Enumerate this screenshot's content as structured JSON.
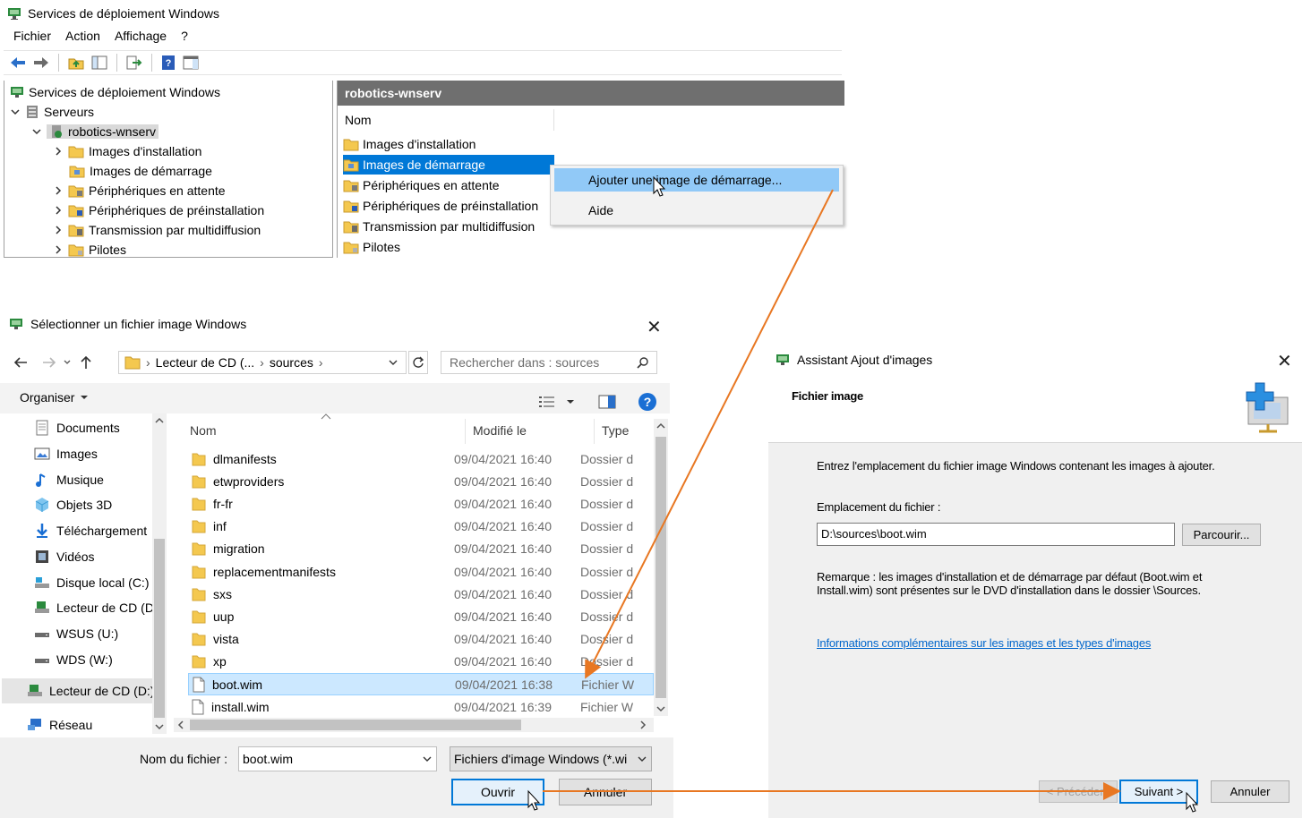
{
  "mmc": {
    "title": "Services de déploiement Windows",
    "menu": [
      "Fichier",
      "Action",
      "Affichage",
      "?"
    ],
    "tree": {
      "root": "Services de déploiement Windows",
      "servers": "Serveurs",
      "server": "robotics-wnserv",
      "children": [
        "Images d'installation",
        "Images de démarrage",
        "Périphériques en attente",
        "Périphériques de préinstallation",
        "Transmission par multidiffusion",
        "Pilotes"
      ]
    },
    "right_header": "robotics-wnserv",
    "column_name": "Nom",
    "items": [
      "Images d'installation",
      "Images de démarrage",
      "Périphériques en attente",
      "Périphériques de préinstallation",
      "Transmission par multidiffusion",
      "Pilotes"
    ],
    "context_menu": [
      "Ajouter une image de démarrage...",
      "Aide"
    ]
  },
  "file_dialog": {
    "title": "Sélectionner un fichier image Windows",
    "address": [
      "Lecteur de CD (...",
      "sources"
    ],
    "search_placeholder": "Rechercher dans : sources",
    "organize": "Organiser",
    "nav": [
      "Documents",
      "Images",
      "Musique",
      "Objets 3D",
      "Téléchargement",
      "Vidéos",
      "Disque local (C:)",
      "Lecteur de CD (D",
      "WSUS (U:)",
      "WDS (W:)",
      "Lecteur de CD (D:)",
      "Réseau"
    ],
    "columns": [
      "Nom",
      "Modifié le",
      "Type"
    ],
    "files": [
      {
        "name": "dlmanifests",
        "date": "09/04/2021 16:40",
        "type": "Dossier d",
        "kind": "folder"
      },
      {
        "name": "etwproviders",
        "date": "09/04/2021 16:40",
        "type": "Dossier d",
        "kind": "folder"
      },
      {
        "name": "fr-fr",
        "date": "09/04/2021 16:40",
        "type": "Dossier d",
        "kind": "folder"
      },
      {
        "name": "inf",
        "date": "09/04/2021 16:40",
        "type": "Dossier d",
        "kind": "folder"
      },
      {
        "name": "migration",
        "date": "09/04/2021 16:40",
        "type": "Dossier d",
        "kind": "folder"
      },
      {
        "name": "replacementmanifests",
        "date": "09/04/2021 16:40",
        "type": "Dossier d",
        "kind": "folder"
      },
      {
        "name": "sxs",
        "date": "09/04/2021 16:40",
        "type": "Dossier d",
        "kind": "folder"
      },
      {
        "name": "uup",
        "date": "09/04/2021 16:40",
        "type": "Dossier d",
        "kind": "folder"
      },
      {
        "name": "vista",
        "date": "09/04/2021 16:40",
        "type": "Dossier d",
        "kind": "folder"
      },
      {
        "name": "xp",
        "date": "09/04/2021 16:40",
        "type": "Dossier d",
        "kind": "folder"
      },
      {
        "name": "boot.wim",
        "date": "09/04/2021 16:38",
        "type": "Fichier W",
        "kind": "file"
      },
      {
        "name": "install.wim",
        "date": "09/04/2021 16:39",
        "type": "Fichier W",
        "kind": "file"
      }
    ],
    "selected_file": "boot.wim",
    "filename_label": "Nom du fichier :",
    "filename_value": "boot.wim",
    "filter": "Fichiers d'image Windows (*.wi",
    "open": "Ouvrir",
    "cancel": "Annuler"
  },
  "wizard": {
    "title": "Assistant Ajout d'images",
    "heading": "Fichier image",
    "intro": "Entrez l'emplacement du fichier image Windows contenant les images à ajouter.",
    "location_label": "Emplacement du fichier :",
    "location_value": "D:\\sources\\boot.wim",
    "browse": "Parcourir...",
    "remark_line1": "Remarque : les images d'installation et de démarrage par défaut (Boot.wim et",
    "remark_line2": "Install.wim) sont présentes sur le DVD d'installation dans le dossier \\Sources.",
    "link": "Informations complémentaires sur les images et les types d'images",
    "prev": "< Précédent",
    "next": "Suivant >",
    "cancel": "Annuler"
  },
  "colors": {
    "selection": "#0078d7",
    "menu_highlight": "#91c9f7",
    "arrow": "#e87722",
    "header_gray": "#6f6f6f",
    "link": "#0066cc",
    "folder": "#f4c84f"
  }
}
